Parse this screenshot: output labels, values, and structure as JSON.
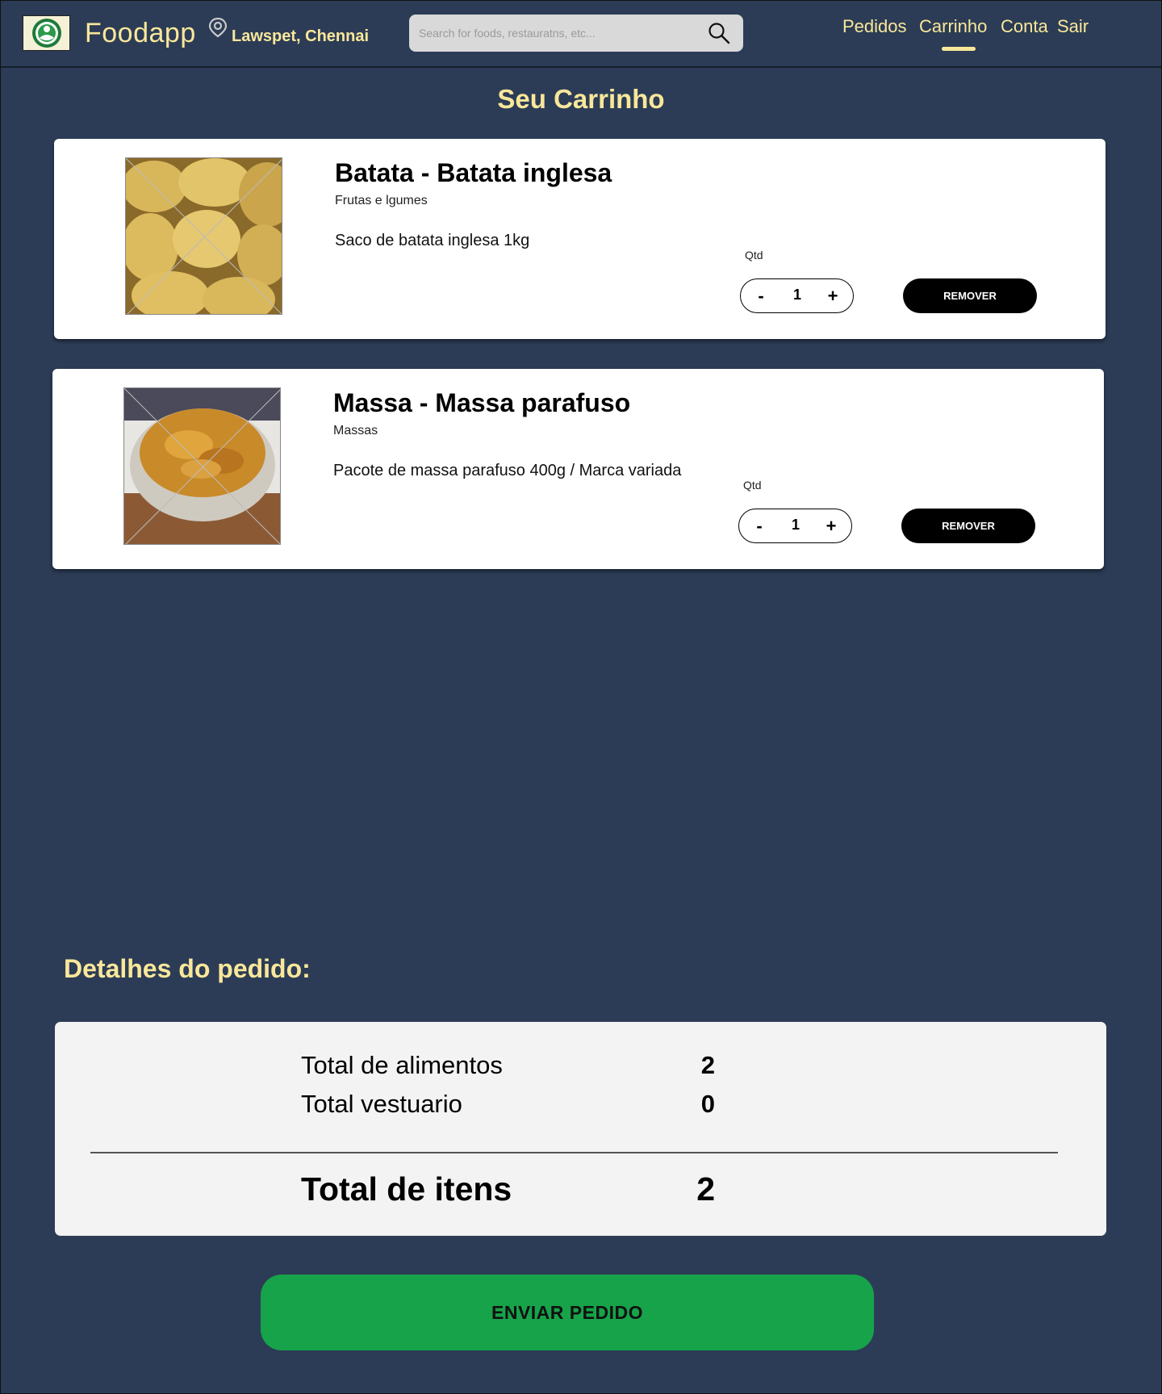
{
  "header": {
    "brand": "Foodapp",
    "location": "Lawspet, Chennai",
    "search_placeholder": "Search for foods, restauratns, etc...",
    "nav": [
      {
        "label": "Pedidos",
        "active": false
      },
      {
        "label": "Carrinho",
        "active": true
      },
      {
        "label": "Conta",
        "active": false
      },
      {
        "label": "Sair",
        "active": false
      }
    ]
  },
  "page_title": "Seu Carrinho",
  "cart_items": [
    {
      "title": "Batata - Batata inglesa",
      "category": "Frutas e lgumes",
      "description": "Saco de batata inglesa 1kg",
      "qty_label": "Qtd",
      "quantity": "1",
      "minus_label": "-",
      "plus_label": "+",
      "remove_label": "REMOVER"
    },
    {
      "title": "Massa - Massa parafuso",
      "category": "Massas",
      "description": "Pacote de massa parafuso 400g / Marca variada",
      "qty_label": "Qtd",
      "quantity": "1",
      "minus_label": "-",
      "plus_label": "+",
      "remove_label": "REMOVER"
    }
  ],
  "details": {
    "title": "Detalhes do pedido:",
    "food_total_label": "Total de alimentos",
    "food_total_value": "2",
    "clothing_total_label": "Total vestuario",
    "clothing_total_value": "0",
    "items_total_label": "Total de itens",
    "items_total_value": "2"
  },
  "submit_label": "ENVIAR PEDIDO",
  "colors": {
    "background": "#2c3c56",
    "accent": "#f9e79a",
    "submit": "#17a34a"
  }
}
